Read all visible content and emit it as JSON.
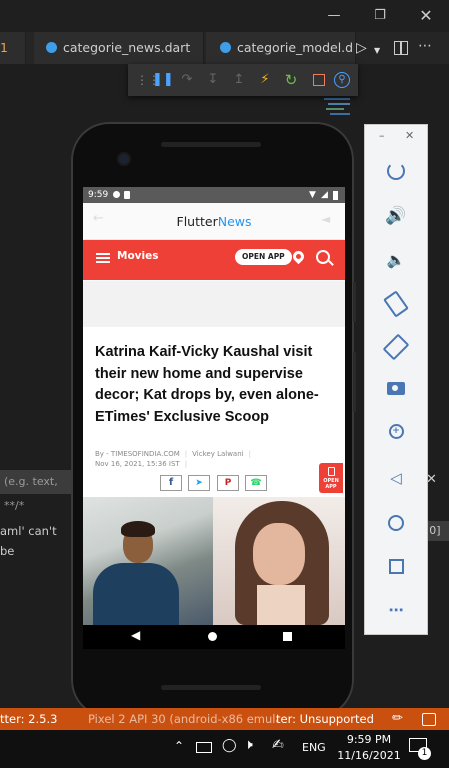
{
  "editor": {
    "tabs": [
      {
        "label": "1"
      },
      {
        "label": "categorie_news.dart"
      },
      {
        "label": "categorie_model.d"
      }
    ],
    "filter_placeholder": "(e.g. text, **/*",
    "error_fragment": "aml' can't be",
    "right_fragment": "'o   0]"
  },
  "status_bar": {
    "flutter_version": "tter: 2.5.3",
    "device": "Pixel 2 API 30 (android-x86 emulator)",
    "platform": "ter: Unsupported"
  },
  "taskbar": {
    "language": "ENG",
    "time": "9:59 PM",
    "date": "11/16/2021",
    "notification_count": "1"
  },
  "phone": {
    "status_time": "9:59",
    "app_title_prefix": "Flutter",
    "app_title_suffix": "News",
    "section": "Movies",
    "open_app": "OPEN APP",
    "headline": "Katrina Kaif-Vicky Kaushal visit their new home and supervise decor; Kat drops by, even alone- ETimes' Exclusive Scoop",
    "byline_source": "By - TIMESOFINDIA.COM",
    "byline_author": "Vickey Lalwani",
    "dateline": "Nov 16, 2021, 15:36 IST",
    "side_badge": "OPEN APP",
    "colors": {
      "brand_red": "#ee4036",
      "title_blue": "#2196f3"
    }
  },
  "emulator_panel": {
    "buttons": [
      "power-icon",
      "volume-up-icon",
      "volume-down-icon",
      "rotate-left-icon",
      "rotate-right-icon",
      "camera-icon",
      "zoom-icon",
      "back-icon",
      "home-icon",
      "overview-icon",
      "more-icon"
    ]
  }
}
